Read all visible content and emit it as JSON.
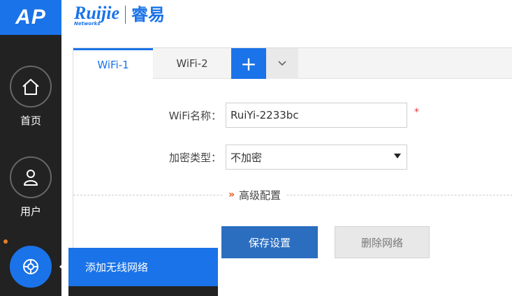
{
  "sidebar": {
    "logo": "AP",
    "items": [
      {
        "label": "首页",
        "icon": "home-icon"
      },
      {
        "label": "用户",
        "icon": "user-icon"
      },
      {
        "label": "",
        "icon": "wireless-icon"
      }
    ]
  },
  "header": {
    "brand_en": "Ruijie",
    "brand_sub": "Networks",
    "brand_cn": "睿易"
  },
  "tabs": [
    {
      "label": "WiFi-1",
      "active": true
    },
    {
      "label": "WiFi-2",
      "active": false
    }
  ],
  "tab_add_label": "+",
  "form": {
    "wifi_name_label": "WiFi名称：",
    "wifi_name_value": "RuiYi-2233bc",
    "required_mark": "*",
    "encryption_label": "加密类型：",
    "encryption_value": "不加密"
  },
  "advanced": {
    "chevron": "»",
    "label": "高级配置"
  },
  "buttons": {
    "save": "保存设置",
    "delete": "删除网络"
  },
  "popup": {
    "label": "添加无线网络"
  },
  "colors": {
    "accent": "#1a73e8",
    "sidebar": "#222222",
    "primary_button": "#2b6ebf",
    "required": "#e23b3b",
    "chevron": "#e8531b"
  }
}
